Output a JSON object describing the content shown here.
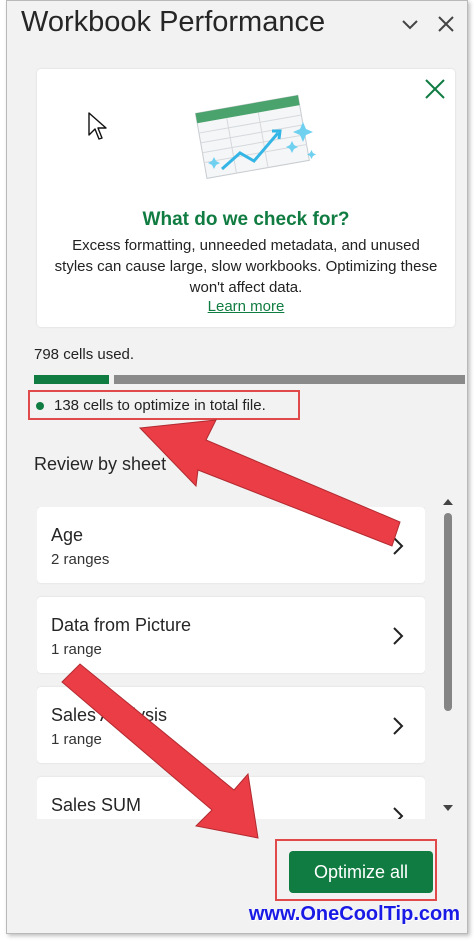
{
  "pane": {
    "title": "Workbook Performance",
    "collapse_icon": "chevron-down-icon",
    "close_icon": "close-icon"
  },
  "info_card": {
    "heading": "What do we check for?",
    "body": "Excess formatting, unneeded metadata, and unused styles can cause large, slow workbooks. Optimizing these won't affect data.",
    "link": "Learn more",
    "close_icon": "close-icon",
    "illustration": "spreadsheet-sparkle-illustration"
  },
  "usage": {
    "cells_used": "798 cells used.",
    "optimizable_fraction": 0.173,
    "optimize_text": "138 cells to optimize in total file."
  },
  "review": {
    "title": "Review by sheet",
    "sheets": [
      {
        "name": "Age",
        "ranges": "2 ranges"
      },
      {
        "name": "Data from Picture",
        "ranges": "1 range"
      },
      {
        "name": "Sales Analysis",
        "ranges": "1 range"
      },
      {
        "name": "Sales SUM",
        "ranges": ""
      }
    ]
  },
  "actions": {
    "optimize_all": "Optimize all"
  },
  "watermark": "www.OneCoolTip.com",
  "colors": {
    "accent_green": "#107c41",
    "annotation_red": "#e04a4a",
    "watermark_blue": "#1a1ae6"
  }
}
